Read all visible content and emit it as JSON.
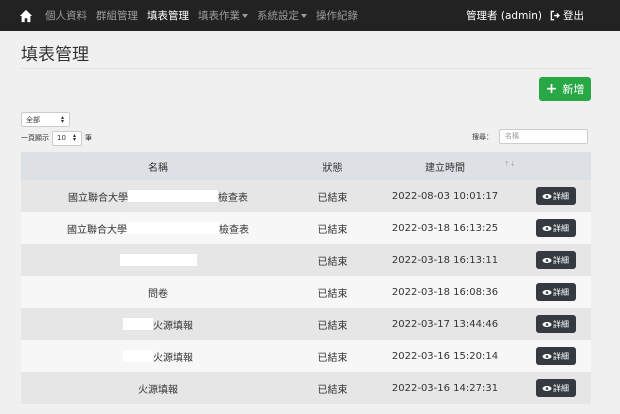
{
  "nav": {
    "items": [
      {
        "label": "個人資料",
        "active": false,
        "dropdown": false
      },
      {
        "label": "群組管理",
        "active": false,
        "dropdown": false
      },
      {
        "label": "填表管理",
        "active": true,
        "dropdown": false
      },
      {
        "label": "填表作業",
        "active": false,
        "dropdown": true
      },
      {
        "label": "系統設定",
        "active": false,
        "dropdown": true
      },
      {
        "label": "操作紀錄",
        "active": false,
        "dropdown": false
      }
    ],
    "user": "管理者 (admin)",
    "logout": "登出"
  },
  "page_title": "填表管理",
  "add_button": "新增",
  "filter": {
    "value": "全部"
  },
  "page_size": {
    "prefix": "一頁顯示",
    "value": "10",
    "suffix": "筆"
  },
  "search": {
    "label": "搜尋：",
    "placeholder": "名稱"
  },
  "table": {
    "headers": {
      "name": "名稱",
      "status": "狀態",
      "created": "建立時間"
    },
    "detail_label": "詳細",
    "rows": [
      {
        "name_prefix": "國立聯合大學",
        "name_suffix": "檢查表",
        "status": "已結束",
        "created": "2022-08-03 10:01:17"
      },
      {
        "name_prefix": "國立聯合大學",
        "name_suffix": "檢查表",
        "status": "已結束",
        "created": "2022-03-18 16:13:25"
      },
      {
        "name_prefix": "",
        "name_suffix": "",
        "status": "已結束",
        "created": "2022-03-18 16:13:11"
      },
      {
        "name_prefix": "問卷",
        "name_suffix": "",
        "status": "已結束",
        "created": "2022-03-18 16:08:36"
      },
      {
        "name_prefix": "",
        "name_suffix": "火源填報",
        "status": "已結束",
        "created": "2022-03-17 13:44:46"
      },
      {
        "name_prefix": "",
        "name_suffix": "火源填報",
        "status": "已結束",
        "created": "2022-03-16 15:20:14"
      },
      {
        "name_prefix": "火源填報",
        "name_suffix": "",
        "status": "已結束",
        "created": "2022-03-16 14:27:31"
      }
    ]
  }
}
